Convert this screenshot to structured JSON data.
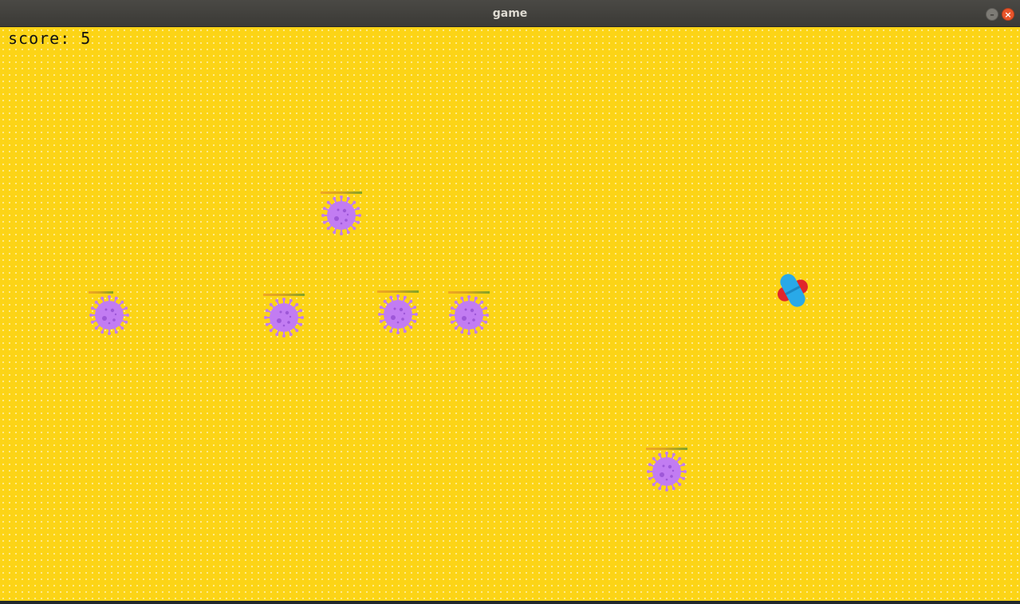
{
  "window": {
    "title": "game"
  },
  "hud": {
    "score_text": "score: 5"
  },
  "colors": {
    "background": "#fcd416",
    "virus": "#c27cf2",
    "virus_dark": "#9e57d8",
    "health_full": "#7fa328",
    "health_low": "#f0a623",
    "pill_blue": "#29a9e8",
    "pill_red": "#e0262b"
  },
  "player": {
    "icon": "medicine-capsule-icon"
  },
  "viruses": [
    {
      "id": "virus-1",
      "icon": "virus-icon",
      "health": 1.0
    },
    {
      "id": "virus-2",
      "icon": "virus-icon",
      "health": 0.6
    },
    {
      "id": "virus-3",
      "icon": "virus-icon",
      "health": 1.0
    },
    {
      "id": "virus-4",
      "icon": "virus-icon",
      "health": 1.0
    },
    {
      "id": "virus-5",
      "icon": "virus-icon",
      "health": 1.0
    },
    {
      "id": "virus-6",
      "icon": "virus-icon",
      "health": 1.0
    }
  ]
}
